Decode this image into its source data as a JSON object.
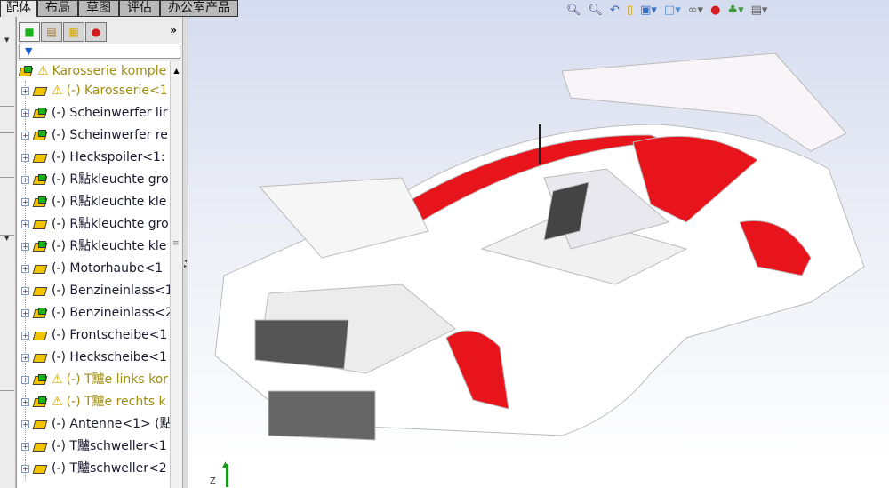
{
  "tabs": [
    {
      "label": "配体"
    },
    {
      "label": "布局"
    },
    {
      "label": "草图"
    },
    {
      "label": "评估"
    },
    {
      "label": "办公室产品"
    }
  ],
  "panel": {
    "more_label": "»",
    "filter_label": "▼"
  },
  "tree": {
    "root": "Karosserie komple",
    "items": [
      {
        "label": "(-) Karosserie<1",
        "warn": true
      },
      {
        "label": "(-) Scheinwerfer lir",
        "warn": false
      },
      {
        "label": "(-) Scheinwerfer re",
        "warn": false
      },
      {
        "label": "(-) Heckspoiler<1:",
        "warn": false
      },
      {
        "label": "(-) R點kleuchte gro",
        "warn": false
      },
      {
        "label": "(-) R點kleuchte kle",
        "warn": false
      },
      {
        "label": "(-) R點kleuchte gro",
        "warn": false
      },
      {
        "label": "(-) R點kleuchte kle",
        "warn": false
      },
      {
        "label": "(-) Motorhaube<1",
        "warn": false
      },
      {
        "label": "(-) Benzineinlass<1",
        "warn": false
      },
      {
        "label": "(-) Benzineinlass<2",
        "warn": false
      },
      {
        "label": "(-) Frontscheibe<1",
        "warn": false
      },
      {
        "label": "(-) Heckscheibe<1",
        "warn": false
      },
      {
        "label": "(-) T黸e links kor",
        "warn": true
      },
      {
        "label": "(-) T黸e rechts k",
        "warn": true
      },
      {
        "label": "(-) Antenne<1> (點",
        "warn": false
      },
      {
        "label": "(-) T黸schweller<1",
        "warn": false
      },
      {
        "label": "(-) T黸schweller<2",
        "warn": false
      }
    ]
  },
  "hud_icons": [
    "zoom-to-fit-icon",
    "zoom-area-icon",
    "previous-view-icon",
    "section-view-icon",
    "view-orientation-icon",
    "display-style-icon",
    "hide-show-icon",
    "edit-appearance-icon",
    "apply-scene-icon",
    "view-settings-icon"
  ],
  "axis_label": "Z",
  "colors": {
    "accent_red": "#e8141c",
    "warn": "#a08d14"
  }
}
